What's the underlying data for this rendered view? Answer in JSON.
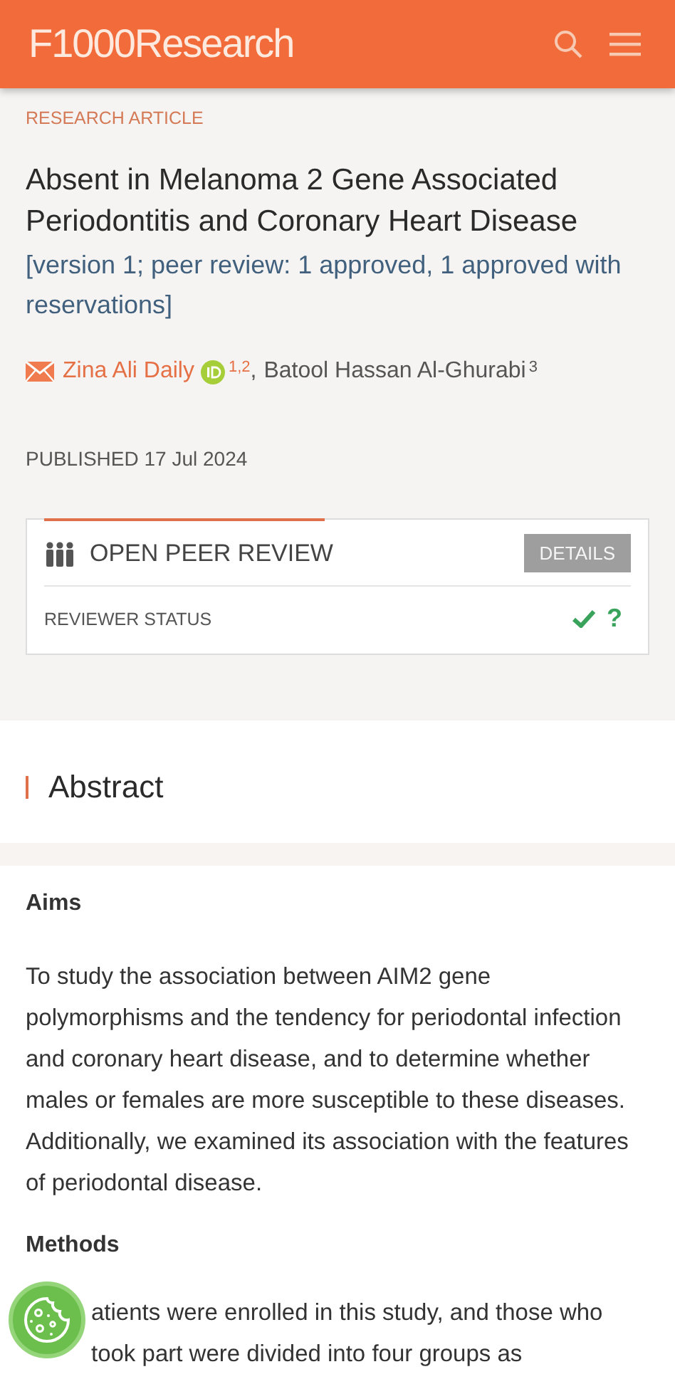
{
  "header": {
    "logo": "F1000Research"
  },
  "article": {
    "type": "RESEARCH ARTICLE",
    "title": "Absent in Melanoma 2 Gene Associated Periodontitis and Coronary Heart Disease",
    "version": "[version 1; peer review: 1 approved, 1 approved with reservations]",
    "authors": [
      {
        "name": "Zina Ali Daily",
        "corresponding": true,
        "orcid": true,
        "affiliations": "1,2",
        "separator": ","
      },
      {
        "name": "Batool Hassan Al-Ghurabi",
        "corresponding": false,
        "orcid": false,
        "affiliations": "3"
      }
    ],
    "published": "PUBLISHED 17 Jul 2024"
  },
  "peer_review": {
    "title": "OPEN PEER REVIEW",
    "details_button": "DETAILS",
    "status_label": "REVIEWER STATUS",
    "statuses": [
      {
        "kind": "approved"
      },
      {
        "kind": "reservations",
        "symbol": "?"
      }
    ]
  },
  "abstract": {
    "heading": "Abstract",
    "sections": [
      {
        "heading": "Aims",
        "text": "To study the association between AIM2 gene polymorphisms and the tendency for periodontal infection and coronary heart disease, and to determine whether males or females are more susceptible to these diseases. Additionally, we examined its association with the features of periodontal disease."
      },
      {
        "heading": "Methods",
        "text": "atients were enrolled in this study, and those who took part were divided into four groups as"
      }
    ]
  }
}
